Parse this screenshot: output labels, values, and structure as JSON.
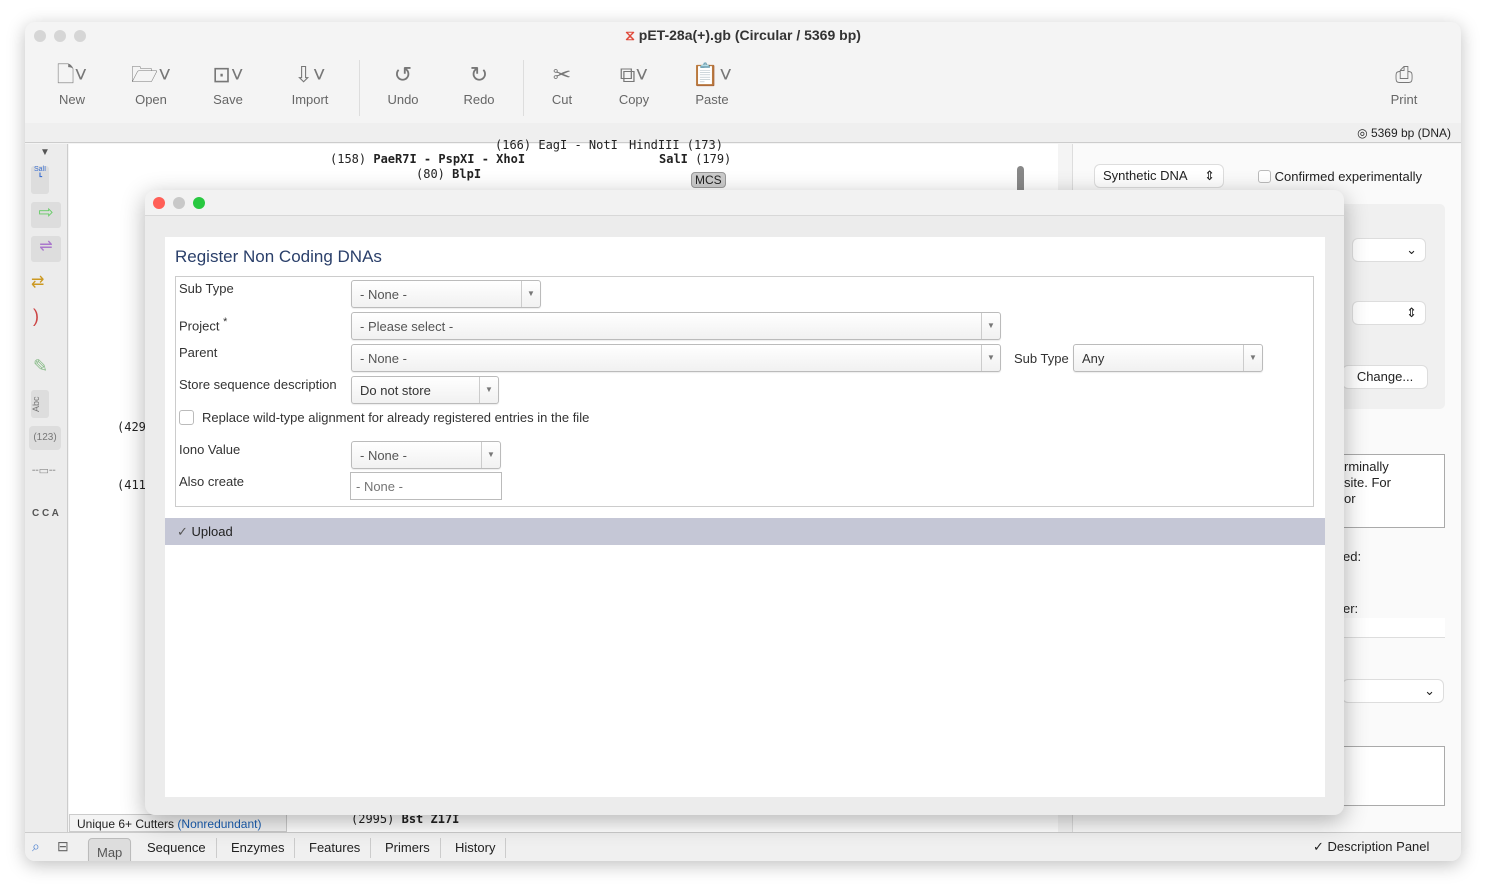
{
  "window": {
    "title": "pET-28a(+).gb  (Circular / 5369 bp)",
    "info": "5369 bp  (DNA)"
  },
  "toolbar": [
    {
      "label": "New",
      "icon": "new-file-icon"
    },
    {
      "label": "Open",
      "icon": "folder-icon"
    },
    {
      "label": "Save",
      "icon": "save-icon"
    },
    {
      "label": "Import",
      "icon": "import-icon"
    },
    {
      "label": "Undo",
      "icon": "undo-icon"
    },
    {
      "label": "Redo",
      "icon": "redo-icon"
    },
    {
      "label": "Cut",
      "icon": "scissors-icon"
    },
    {
      "label": "Copy",
      "icon": "copy-icon"
    },
    {
      "label": "Paste",
      "icon": "paste-icon"
    },
    {
      "label": "Print",
      "icon": "printer-icon"
    }
  ],
  "map": {
    "sites": [
      "(158)",
      "PaeR7I - PspXI - XhoI",
      "(80)",
      "BlpI",
      "SalI",
      "(179)",
      "(166)  EagI - NotI",
      "HindIII  (173)",
      "(4298",
      "(4117",
      "(2995)",
      "Bst Z17I"
    ],
    "mcs": "MCS",
    "cutters_label": "Unique 6+ Cutters",
    "cutters_mode": "(Nonredundant)"
  },
  "sidebar": {
    "sali": "SalI",
    "abc": "Abc",
    "num": "(123)",
    "cca": "C C A"
  },
  "right_panel": {
    "molecule_type": "Synthetic DNA",
    "confirmed_label": "Confirmed experimentally",
    "change_button": "Change...",
    "desc_fragment": [
      "rminally",
      "site. For",
      "or"
    ],
    "frag1": "ed:",
    "frag2": "er:"
  },
  "bottom_tabs": [
    "Map",
    "Sequence",
    "Enzymes",
    "Features",
    "Primers",
    "History"
  ],
  "description_panel": "Description Panel",
  "dialog": {
    "heading": "Register Non Coding DNAs",
    "sub_type": {
      "label": "Sub Type",
      "value": "- None -"
    },
    "project": {
      "label": "Project",
      "required": "*",
      "value": "- Please select -"
    },
    "parent": {
      "label": "Parent",
      "value": "- None -",
      "sub_type_label": "Sub Type",
      "sub_type_value": "Any"
    },
    "store_desc": {
      "label": "Store sequence description",
      "value": "Do not store"
    },
    "replace_label": "Replace wild-type alignment for already registered entries in the file",
    "iono": {
      "label": "Iono Value",
      "value": "- None -"
    },
    "also_create": {
      "label": "Also create",
      "placeholder": "- None -"
    },
    "upload_label": "Upload"
  },
  "colors": {
    "upload_bar": "#c5c7d6",
    "link": "#1a5fb4",
    "close": "#ff5f57",
    "minimize": "#c8c8c8",
    "zoom": "#28c840"
  }
}
